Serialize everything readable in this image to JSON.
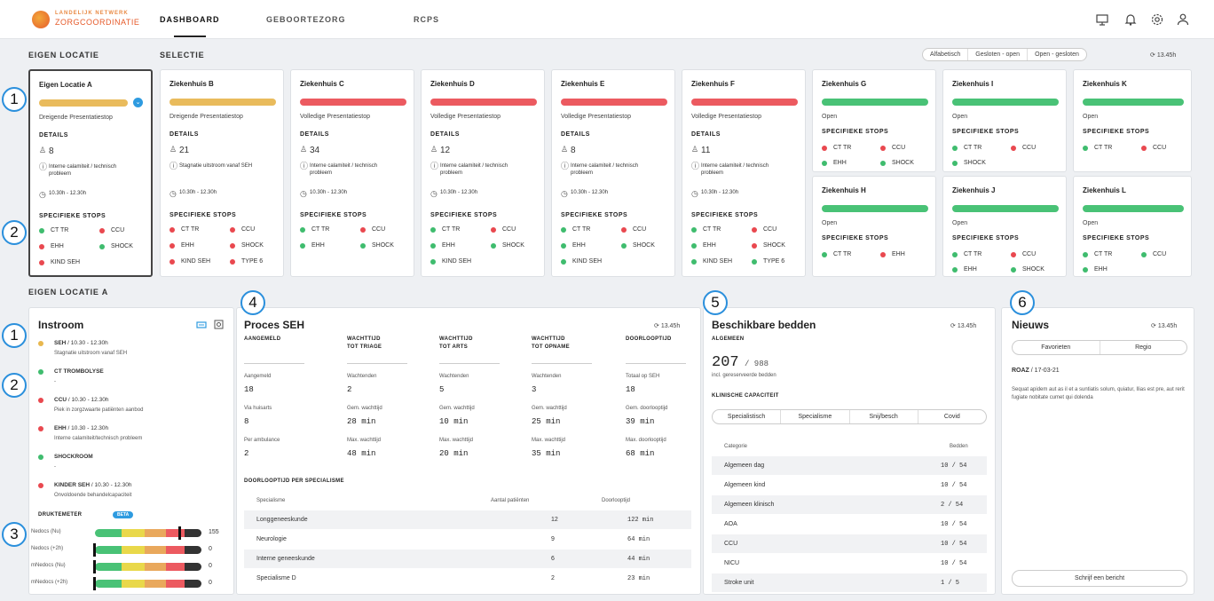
{
  "nav": {
    "logo_line1": "LANDELIJK NETWERK",
    "logo_line2": "ZORGCOORDINATIE",
    "tabs": [
      "DASHBOARD",
      "GEBOORTEZORG",
      "RCPS"
    ]
  },
  "header": {
    "eigen_locatie": "EIGEN LOCATIE",
    "selectie": "SELECTIE",
    "sort_options": [
      "Alfabetisch",
      "Gesloten - open",
      "Open - gesloten"
    ],
    "refresh": "13.45h"
  },
  "labels": {
    "details": "DETAILS",
    "specifieke_stops": "SPECIFIEKE STOPS"
  },
  "cards": [
    {
      "name": "Eigen Locatie A",
      "status": "Dreigende Presentatiestop",
      "color": "#e9bb5c",
      "count": "8",
      "reason": "Interne calamiteit / technisch probleem",
      "time": "10.30h - 12.30h",
      "stops": [
        {
          "label": "CT TR",
          "c": "g"
        },
        {
          "label": "CCU",
          "c": "r"
        },
        {
          "label": "EHH",
          "c": "r"
        },
        {
          "label": "SHOCK",
          "c": "g"
        },
        {
          "label": "KIND SEH",
          "c": "r"
        }
      ]
    },
    {
      "name": "Ziekenhuis B",
      "status": "Dreigende Presentatiestop",
      "color": "#e9bb5c",
      "count": "21",
      "reason": "Stagnatie uitstroom vanaf SEH",
      "time": "10.30h - 12.30h",
      "stops": [
        {
          "label": "CT TR",
          "c": "r"
        },
        {
          "label": "CCU",
          "c": "r"
        },
        {
          "label": "EHH",
          "c": "r"
        },
        {
          "label": "SHOCK",
          "c": "r"
        },
        {
          "label": "KIND SEH",
          "c": "r"
        },
        {
          "label": "TYPE 6",
          "c": "r"
        }
      ]
    },
    {
      "name": "Ziekenhuis C",
      "status": "Volledige Presentatiestop",
      "color": "#ec5a60",
      "count": "34",
      "reason": "Interne calamiteit / technisch probleem",
      "time": "10.30h - 12.30h",
      "stops": [
        {
          "label": "CT TR",
          "c": "g"
        },
        {
          "label": "CCU",
          "c": "r"
        },
        {
          "label": "EHH",
          "c": "g"
        },
        {
          "label": "SHOCK",
          "c": "g"
        }
      ]
    },
    {
      "name": "Ziekenhuis D",
      "status": "Volledige Presentatiestop",
      "color": "#ec5a60",
      "count": "12",
      "reason": "Interne calamiteit / technisch probleem",
      "time": "10.30h - 12.30h",
      "stops": [
        {
          "label": "CT TR",
          "c": "g"
        },
        {
          "label": "CCU",
          "c": "r"
        },
        {
          "label": "EHH",
          "c": "g"
        },
        {
          "label": "SHOCK",
          "c": "g"
        },
        {
          "label": "KIND SEH",
          "c": "g"
        }
      ]
    },
    {
      "name": "Ziekenhuis E",
      "status": "Volledige Presentatiestop",
      "color": "#ec5a60",
      "count": "8",
      "reason": "Interne calamiteit / technisch probleem",
      "time": "10.30h - 12.30h",
      "stops": [
        {
          "label": "CT TR",
          "c": "g"
        },
        {
          "label": "CCU",
          "c": "r"
        },
        {
          "label": "EHH",
          "c": "g"
        },
        {
          "label": "SHOCK",
          "c": "g"
        },
        {
          "label": "KIND SEH",
          "c": "g"
        }
      ]
    },
    {
      "name": "Ziekenhuis F",
      "status": "Volledige Presentatiestop",
      "color": "#ec5a60",
      "count": "11",
      "reason": "Interne calamiteit / technisch probleem",
      "time": "10.30h - 12.30h",
      "stops": [
        {
          "label": "CT TR",
          "c": "g"
        },
        {
          "label": "CCU",
          "c": "r"
        },
        {
          "label": "EHH",
          "c": "g"
        },
        {
          "label": "SHOCK",
          "c": "r"
        },
        {
          "label": "KIND SEH",
          "c": "g"
        },
        {
          "label": "TYPE 6",
          "c": "g"
        }
      ]
    }
  ],
  "small_cards": [
    {
      "name": "Ziekenhuis G",
      "status": "Open",
      "stops": [
        {
          "label": "CT TR",
          "c": "r"
        },
        {
          "label": "CCU",
          "c": "r"
        },
        {
          "label": "EHH",
          "c": "g"
        },
        {
          "label": "SHOCK",
          "c": "g"
        }
      ]
    },
    {
      "name": "Ziekenhuis I",
      "status": "Open",
      "stops": [
        {
          "label": "CT TR",
          "c": "g"
        },
        {
          "label": "CCU",
          "c": "r"
        },
        {
          "label": "SHOCK",
          "c": "g"
        }
      ]
    },
    {
      "name": "Ziekenhuis K",
      "status": "Open",
      "stops": [
        {
          "label": "CT TR",
          "c": "g"
        },
        {
          "label": "CCU",
          "c": "r"
        }
      ]
    },
    {
      "name": "Ziekenhuis H",
      "status": "Open",
      "stops": [
        {
          "label": "CT TR",
          "c": "g"
        },
        {
          "label": "EHH",
          "c": "r"
        }
      ]
    },
    {
      "name": "Ziekenhuis J",
      "status": "Open",
      "stops": [
        {
          "label": "CT TR",
          "c": "g"
        },
        {
          "label": "CCU",
          "c": "r"
        },
        {
          "label": "EHH",
          "c": "g"
        },
        {
          "label": "SHOCK",
          "c": "g"
        }
      ]
    },
    {
      "name": "Ziekenhuis L",
      "status": "Open",
      "stops": [
        {
          "label": "CT TR",
          "c": "g"
        },
        {
          "label": "CCU",
          "c": "g"
        },
        {
          "label": "EHH",
          "c": "g"
        }
      ]
    }
  ],
  "section_a": "EIGEN LOCATIE A",
  "instroom": {
    "title": "Instroom",
    "items": [
      {
        "c": "y",
        "name": "SEH",
        "time": " / 10.30 - 12.30h",
        "desc": "Stagnatie uitstroom vanaf SEH"
      },
      {
        "c": "g",
        "name": "CT TROMBOLYSE",
        "time": "",
        "desc": "-"
      },
      {
        "c": "r",
        "name": "CCU",
        "time": " / 10.30 - 12.30h",
        "desc": "Piek in zorgzwaarte patiënten aanbod"
      },
      {
        "c": "r",
        "name": "EHH",
        "time": " / 10.30 - 12.30h",
        "desc": "Interne calamiteit/technisch probleem"
      },
      {
        "c": "g",
        "name": "SHOCKROOM",
        "time": "",
        "desc": "-"
      },
      {
        "c": "r",
        "name": "KINDER SEH",
        "time": " / 10.30 - 12.30h",
        "desc": "Onvoldoende behandelcapaciteit"
      }
    ],
    "druktemeter": "DRUKTEMETER",
    "beta": "BETA",
    "meters": [
      {
        "label": "Nedocs (Nu)",
        "value": "155",
        "level": 0.8
      },
      {
        "label": "Nedocs (+2h)",
        "value": "0",
        "level": 0
      },
      {
        "label": "mNedocs (Nu)",
        "value": "0",
        "level": 0
      },
      {
        "label": "mNedocs (+2h)",
        "value": "0",
        "level": 0
      }
    ]
  },
  "proces": {
    "title": "Proces SEH",
    "refresh": "13.45h",
    "cols": [
      {
        "h1": "AANGEMELD",
        "h2": "",
        "r": [
          [
            "Aangemeld",
            "18"
          ],
          [
            "Via huisarts",
            "8"
          ],
          [
            "Per ambulance",
            "2"
          ]
        ]
      },
      {
        "h1": "WACHTTIJD",
        "h2": "TOT TRIAGE",
        "r": [
          [
            "Wachtenden",
            "2"
          ],
          [
            "Gem. wachttijd",
            "28 min"
          ],
          [
            "Max. wachttijd",
            "48 min"
          ]
        ]
      },
      {
        "h1": "WACHTTIJD",
        "h2": "TOT ARTS",
        "r": [
          [
            "Wachtenden",
            "5"
          ],
          [
            "Gem. wachttijd",
            "10 min"
          ],
          [
            "Max. wachttijd",
            "20 min"
          ]
        ]
      },
      {
        "h1": "WACHTTIJD",
        "h2": "TOT OPNAME",
        "r": [
          [
            "Wachtenden",
            "3"
          ],
          [
            "Gem. wachttijd",
            "25 min"
          ],
          [
            "Max. wachttijd",
            "35 min"
          ]
        ]
      },
      {
        "h1": "DOORLOOPTIJD",
        "h2": "",
        "r": [
          [
            "Totaal op SEH",
            "18"
          ],
          [
            "Gem. doorlooptijd",
            "39 min"
          ],
          [
            "Max. doorlooptijd",
            "68 min"
          ]
        ]
      }
    ],
    "doorloop_title": "DOORLOOPTIJD PER SPECIALISME",
    "table_head": [
      "Specialisme",
      "Aantal patiënten",
      "Doorlooptijd"
    ],
    "table": [
      [
        "Longgeneeskunde",
        "12",
        "122 min"
      ],
      [
        "Neurologie",
        "9",
        "64 min"
      ],
      [
        "Interne geneeskunde",
        "6",
        "44 min"
      ],
      [
        "Specialisme D",
        "2",
        "23 min"
      ]
    ]
  },
  "bedden": {
    "title": "Beschikbare bedden",
    "refresh": "13.45h",
    "algemeen": "ALGEMEEN",
    "total": "207",
    "total_of": "/ 988",
    "incl": "incl. gereserveerde bedden",
    "klinisch": "KLINISCHE CAPACITEIT",
    "tabs": [
      "Specialistisch",
      "Specialisme",
      "Snij/besch",
      "Covid"
    ],
    "head": [
      "Categorie",
      "Bedden"
    ],
    "rows": [
      [
        "Algemeen dag",
        "10 / 54"
      ],
      [
        "Algemeen kind",
        "10 / 54"
      ],
      [
        "Algemeen klinisch",
        "2 / 54"
      ],
      [
        "AOA",
        "10 / 54"
      ],
      [
        "CCU",
        "10 / 54"
      ],
      [
        "NICU",
        "10 / 54"
      ],
      [
        "Stroke unit",
        "1 / 5"
      ]
    ]
  },
  "nieuws": {
    "title": "Nieuws",
    "refresh": "13.45h",
    "tabs": [
      "Favorieten",
      "Regio"
    ],
    "source": "ROAZ",
    "date": " / 17-03-21",
    "body": "Sequat apidem aut as il et a suntiatis solum, quiatur, Ilias est pre, aut rerit fugiate nobitate cumet qui dolenda",
    "button": "Schrijf een bericht"
  },
  "callouts": [
    "1",
    "2",
    "1",
    "2",
    "3",
    "4",
    "5",
    "6"
  ]
}
